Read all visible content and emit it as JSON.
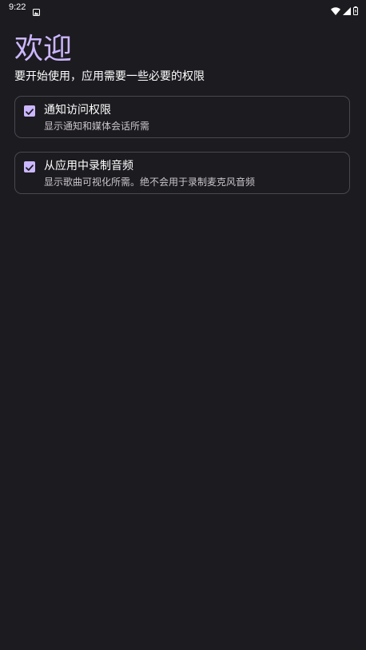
{
  "status_bar": {
    "time": "9:22",
    "notification_icon": "photo-icon",
    "wifi_icon": "wifi-icon",
    "signal_icon": "signal-icon",
    "battery_icon": "battery-icon"
  },
  "header": {
    "title": "欢迎",
    "subtitle": "要开始使用，应用需要一些必要的权限"
  },
  "permissions": [
    {
      "title": "通知访问权限",
      "description": "显示通知和媒体会话所需",
      "checked": true
    },
    {
      "title": "从应用中录制音频",
      "description": "显示歌曲可视化所需。绝不会用于录制麦克风音频",
      "checked": true
    }
  ],
  "colors": {
    "background": "#1c1b20",
    "accent": "#cbb7ff",
    "card_border": "#4a4850"
  }
}
